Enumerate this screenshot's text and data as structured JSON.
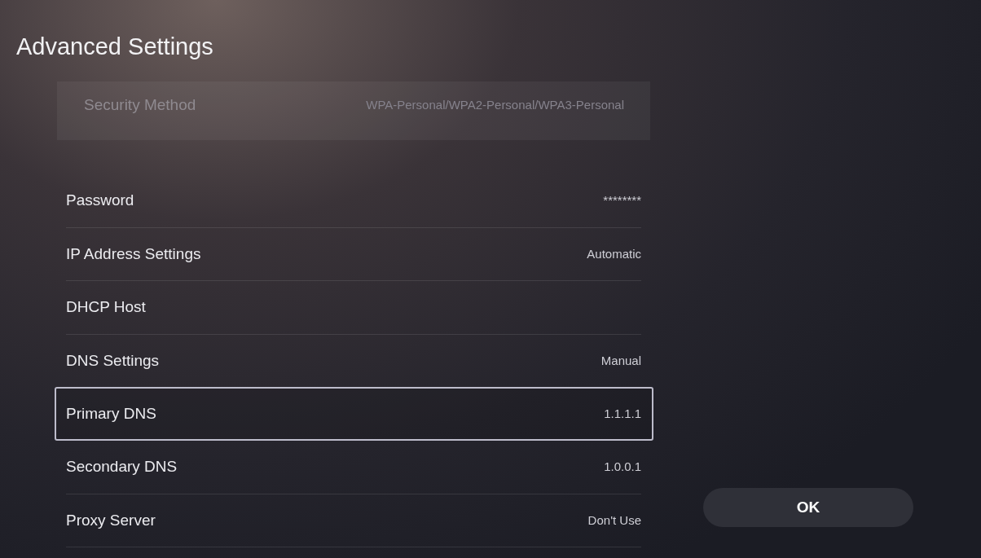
{
  "screen": {
    "title": "Advanced Settings"
  },
  "settings": [
    {
      "label": "Security Method",
      "value": "WPA-Personal/WPA2-Personal/WPA3-Personal",
      "disabled": true,
      "selected": false
    },
    {
      "label": "Password",
      "value": "********",
      "disabled": false,
      "selected": false
    },
    {
      "label": "IP Address Settings",
      "value": "Automatic",
      "disabled": false,
      "selected": false
    },
    {
      "label": "DHCP Host",
      "disabled": false,
      "selected": false
    },
    {
      "label": "DNS Settings",
      "value": "Manual",
      "disabled": false,
      "selected": false
    },
    {
      "label": "Primary DNS",
      "value": "1.1.1.1",
      "disabled": false,
      "selected": true
    },
    {
      "label": "Secondary DNS",
      "value": "1.0.0.1",
      "disabled": false,
      "selected": false
    },
    {
      "label": "Proxy Server",
      "value": "Don't Use",
      "disabled": false,
      "selected": false
    }
  ],
  "ok_button": {
    "label": "OK"
  }
}
